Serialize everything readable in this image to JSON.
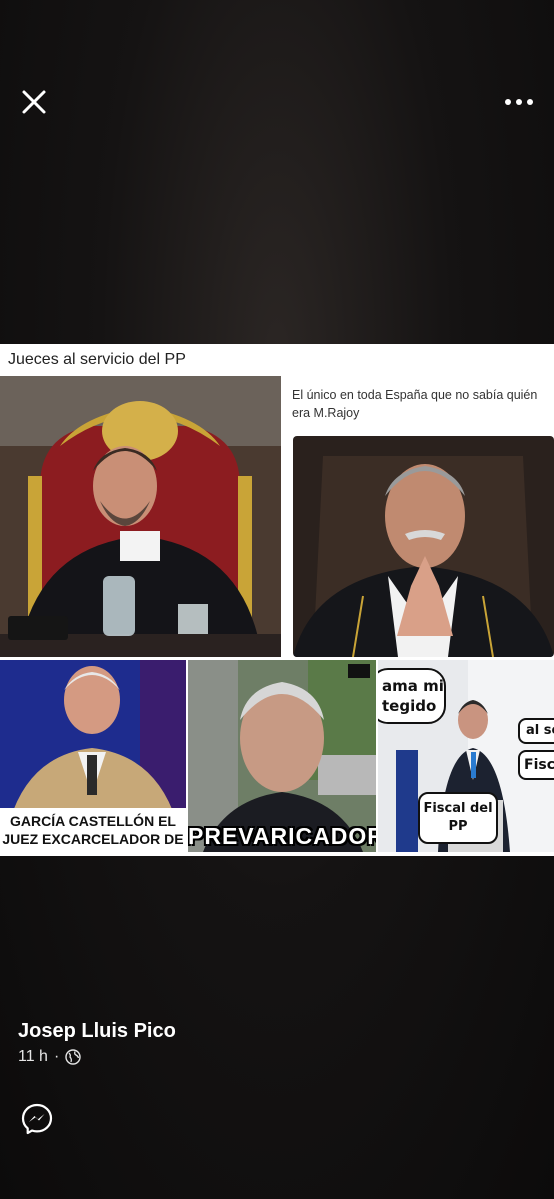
{
  "viewer": {
    "close_icon": "close-icon",
    "more_icon": "more-options-icon"
  },
  "post": {
    "caption": "Jueces al servicio del PP",
    "panel_2_text": "El único en toda España que no sabía quién era M.Rajoy",
    "panel_3_line_1": "GARCÍA CASTELLÓN EL",
    "panel_3_line_2": "JUEZ EXCARCELADOR DE",
    "panel_4_banner": "PREVARICADOR",
    "panel_5_bubble_1": "ama mi tegido",
    "panel_5_bubble_2": "Fiscal del PP",
    "panel_5_bubble_3": "al se",
    "panel_5_bubble_4": "Fisca"
  },
  "author": {
    "name": "Josep Lluis Pico",
    "time": "11 h",
    "separator": "·",
    "audience_icon": "globe-icon"
  },
  "actions": {
    "messenger_icon": "messenger-icon"
  }
}
